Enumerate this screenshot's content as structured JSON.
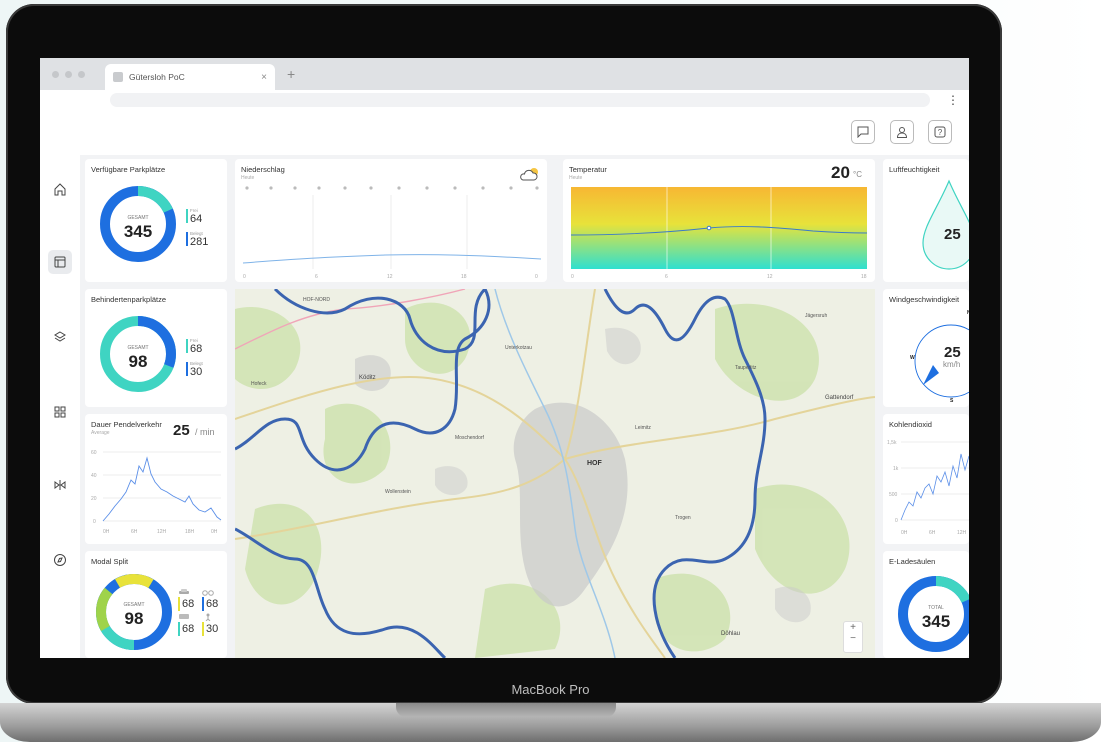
{
  "browser": {
    "tab_title": "Gütersloh PoC",
    "close": "×",
    "new_tab": "+",
    "menu": "⋮"
  },
  "footer": {
    "label": "MacBook Pro"
  },
  "parking": {
    "title": "Verfügbare Parkplätze",
    "center_label": "GESAMT",
    "total": "345",
    "a_label": "Frei",
    "a_value": "64",
    "b_label": "Belegt",
    "b_value": "281"
  },
  "disabled": {
    "title": "Behindertenparkplätze",
    "center_label": "GESAMT",
    "total": "98",
    "a_label": "Frei",
    "a_value": "68",
    "b_label": "Belegt",
    "b_value": "30"
  },
  "commute": {
    "title": "Dauer Pendelverkehr",
    "subtitle": "Average",
    "value": "25",
    "unit": "/ min",
    "y_ticks": [
      "60",
      "40",
      "20",
      "0"
    ],
    "x_ticks": [
      "0H",
      "6H",
      "12H",
      "18H",
      "0H"
    ]
  },
  "modal": {
    "title": "Modal Split",
    "center_label": "GESAMT",
    "total": "98",
    "values": [
      "68",
      "68",
      "68",
      "30"
    ]
  },
  "rain": {
    "title": "Niederschlag",
    "subtitle": "Heute",
    "x_ticks": [
      "0",
      "6",
      "12",
      "18",
      "0"
    ]
  },
  "temp": {
    "title": "Temperatur",
    "subtitle": "Heute",
    "value": "20",
    "unit": "°C",
    "x_ticks": [
      "0",
      "6",
      "12",
      "18"
    ]
  },
  "humidity": {
    "title": "Luftfeuchtigkeit",
    "value": "25"
  },
  "wind": {
    "title": "Windgeschwindigkeit",
    "value": "25",
    "unit": "km/h",
    "n": "N",
    "w": "W",
    "s": "S"
  },
  "co2": {
    "title": "Kohlendioxid",
    "y_ticks": [
      "1,5k",
      "1k",
      "500",
      "0"
    ],
    "x_ticks": [
      "0H",
      "6H",
      "12H"
    ]
  },
  "charging": {
    "title": "E-Ladesäulen",
    "center_label": "TOTAL",
    "total": "345"
  },
  "map": {
    "labels": [
      "Köditz",
      "Gattendorf",
      "HOF",
      "Döhlau",
      "Wollenstein",
      "HOF-NORD",
      "Unterkotzau",
      "Trogen",
      "Jägersruh",
      "Hofeck",
      "Leimitz",
      "Moschendorf",
      "Tauperlitz"
    ],
    "zoom_in": "+",
    "zoom_out": "−"
  },
  "colors": {
    "blue": "#1e6fe0",
    "teal": "#3fd4c2",
    "yellow": "#e8e23a",
    "green": "#9fd34a",
    "border": "#3b64b0"
  }
}
